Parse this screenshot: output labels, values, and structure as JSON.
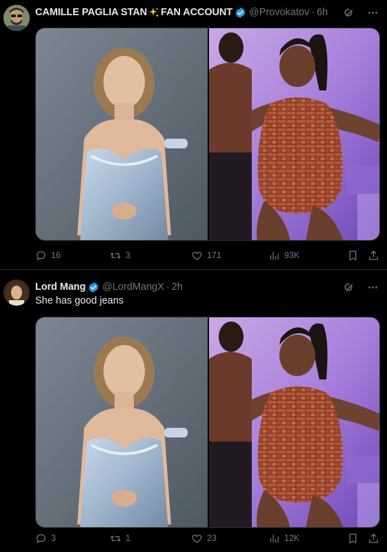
{
  "tweets": [
    {
      "author_name": "CAMILLE PAGLIA STAN",
      "author_name_suffix": "FAN ACCOUNT",
      "handle": "@Provokatov",
      "separator": "·",
      "time": "6h",
      "text": "",
      "replies": "16",
      "retweets": "3",
      "likes": "171",
      "views": "93K"
    },
    {
      "author_name": "Lord Mang",
      "author_name_suffix": "",
      "handle": "@LordMangX",
      "separator": "·",
      "time": "2h",
      "text": "She has good jeans",
      "replies": "3",
      "retweets": "1",
      "likes": "23",
      "views": "12K"
    }
  ],
  "icons": {
    "verified": "verified-badge-icon",
    "sparkle": "sparkles-icon",
    "grok": "grok-icon",
    "more": "more-icon",
    "reply": "reply-icon",
    "retweet": "retweet-icon",
    "like": "heart-icon",
    "views": "views-icon",
    "bookmark": "bookmark-icon",
    "share": "share-icon"
  },
  "colors": {
    "background": "#000000",
    "text_primary": "#e7e9ea",
    "text_secondary": "#71767b",
    "verified_blue": "#1d9bf0",
    "divider": "#2f3336"
  }
}
